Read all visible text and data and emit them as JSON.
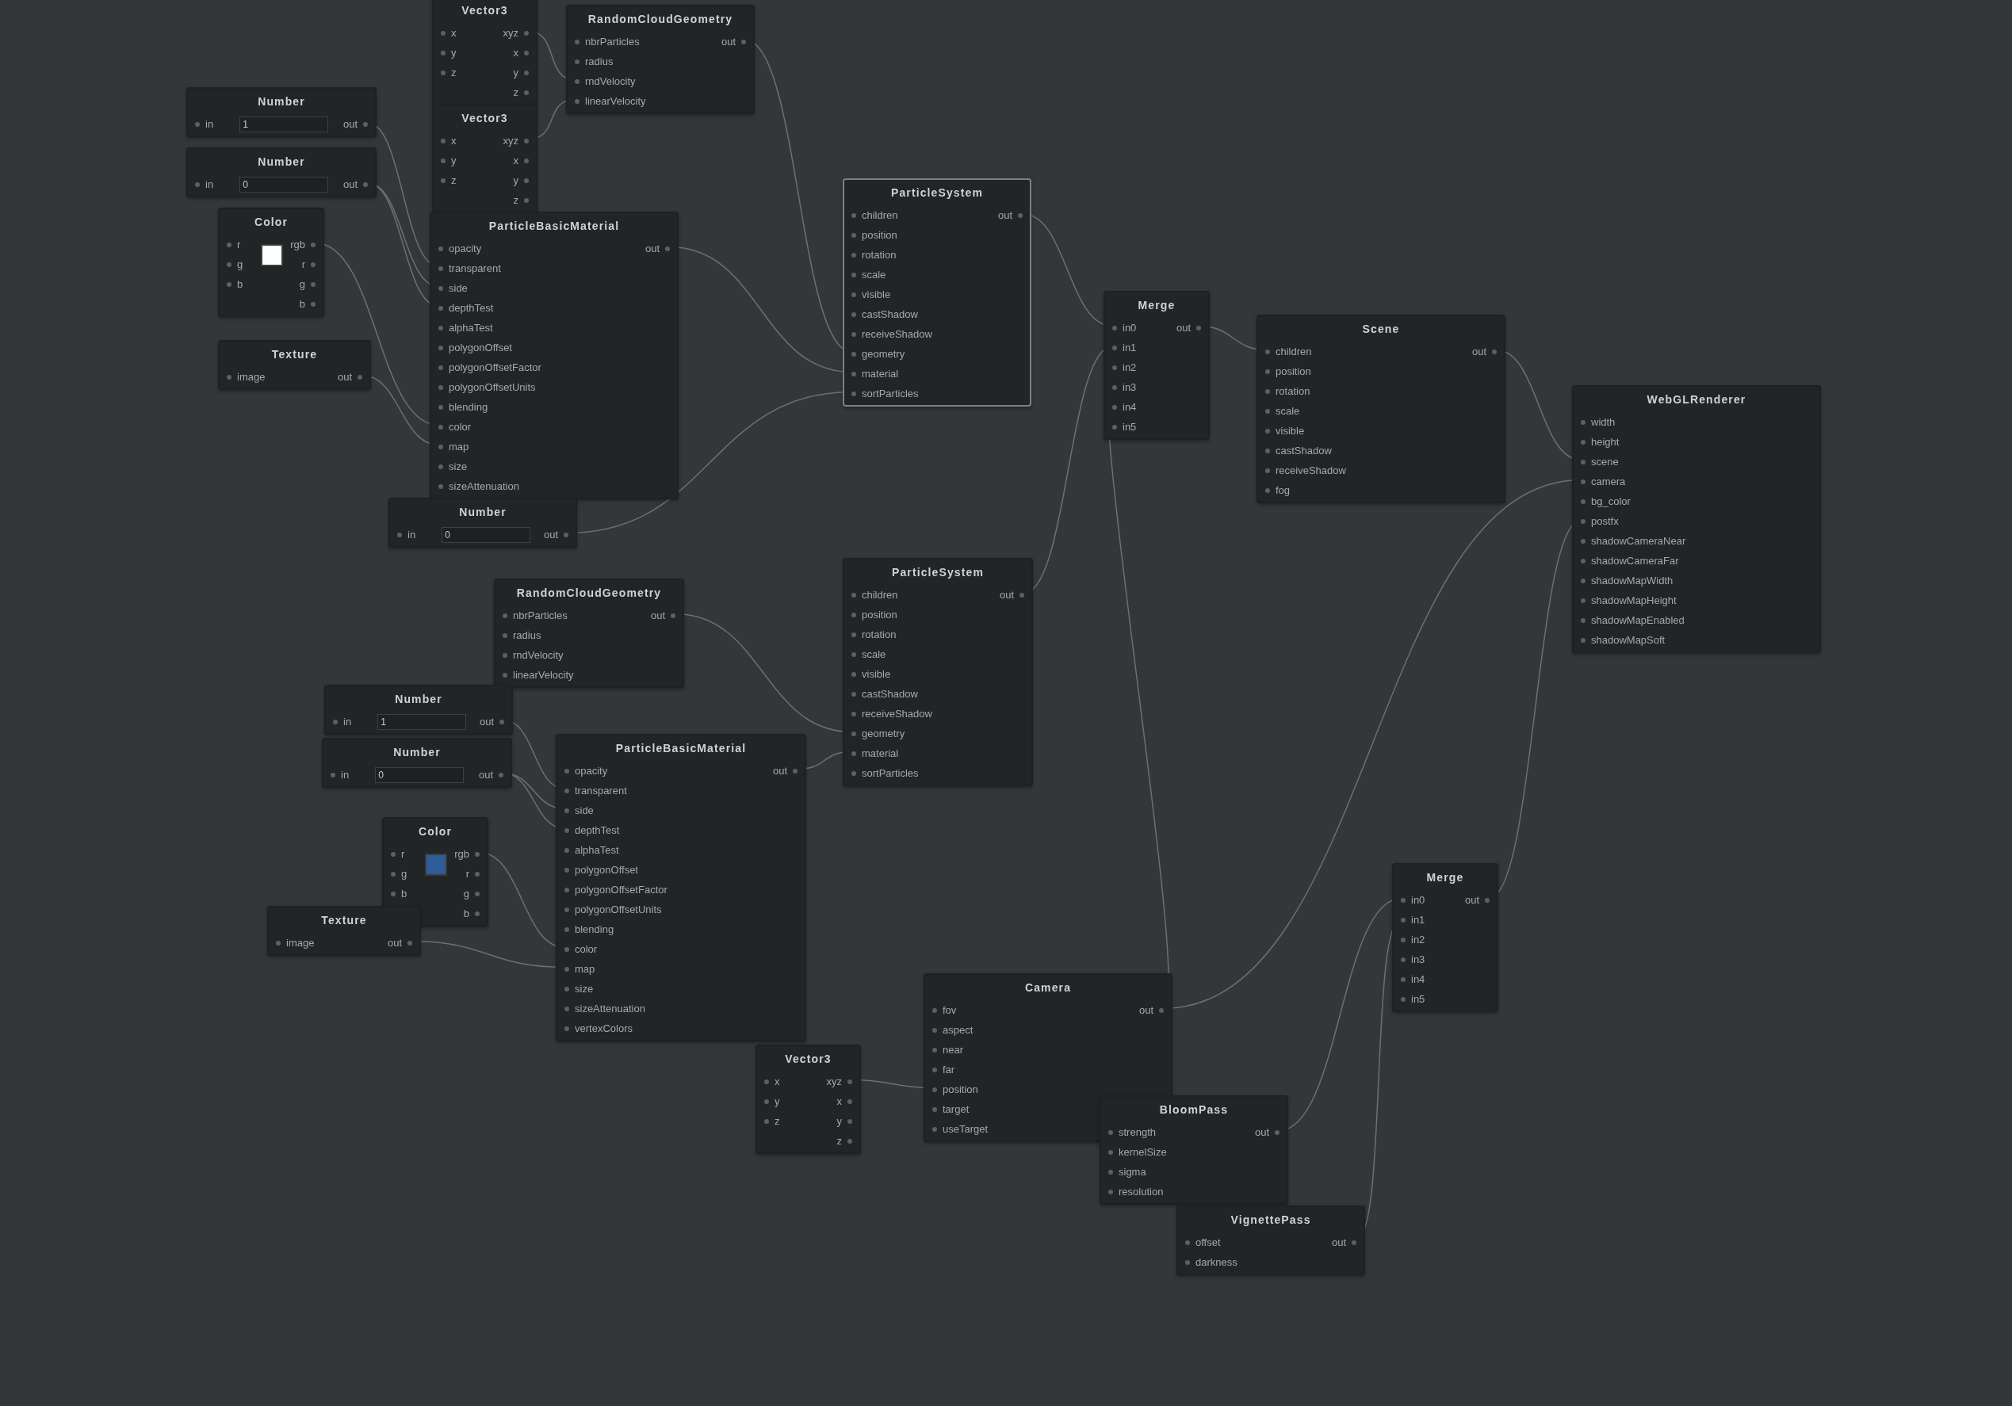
{
  "nodes": [
    {
      "kind": "basic",
      "title": "Vector3",
      "selected": false,
      "inputs": [
        "x",
        "y",
        "z"
      ],
      "outputs": [
        "xyz",
        "x",
        "y",
        "z"
      ]
    },
    {
      "kind": "basic",
      "title": "RandomCloudGeometry",
      "selected": false,
      "inputs": [
        "nbrParticles",
        "radius",
        "rndVelocity",
        "linearVelocity"
      ],
      "outputs": [
        "out"
      ]
    },
    {
      "kind": "number",
      "title": "Number",
      "selected": false,
      "inputs": [
        "in"
      ],
      "outputs": [
        "out"
      ],
      "value": "1"
    },
    {
      "kind": "number",
      "title": "Number",
      "selected": false,
      "inputs": [
        "in"
      ],
      "outputs": [
        "out"
      ],
      "value": "0"
    },
    {
      "kind": "basic",
      "title": "Vector3",
      "selected": false,
      "inputs": [
        "x",
        "y",
        "z"
      ],
      "outputs": [
        "xyz",
        "x",
        "y",
        "z"
      ]
    },
    {
      "kind": "color",
      "title": "Color",
      "selected": false,
      "inputs": [
        "r",
        "g",
        "b"
      ],
      "outputs": [
        "rgb",
        "r",
        "g",
        "b"
      ],
      "color": "#ffffff"
    },
    {
      "kind": "basic",
      "title": "ParticleBasicMaterial",
      "selected": false,
      "inputs": [
        "opacity",
        "transparent",
        "side",
        "depthTest",
        "alphaTest",
        "polygonOffset",
        "polygonOffsetFactor",
        "polygonOffsetUnits",
        "blending",
        "color",
        "map",
        "size",
        "sizeAttenuation"
      ],
      "outputs": [
        "out"
      ]
    },
    {
      "kind": "basic",
      "title": "Texture",
      "selected": false,
      "inputs": [
        "image"
      ],
      "outputs": [
        "out"
      ]
    },
    {
      "kind": "number",
      "title": "Number",
      "selected": false,
      "inputs": [
        "in"
      ],
      "outputs": [
        "out"
      ],
      "value": "0"
    },
    {
      "kind": "basic",
      "title": "ParticleSystem",
      "selected": true,
      "inputs": [
        "children",
        "position",
        "rotation",
        "scale",
        "visible",
        "castShadow",
        "receiveShadow",
        "geometry",
        "material",
        "sortParticles"
      ],
      "outputs": [
        "out"
      ]
    },
    {
      "kind": "basic",
      "title": "Merge",
      "selected": false,
      "inputs": [
        "in0",
        "in1",
        "in2",
        "in3",
        "in4",
        "in5"
      ],
      "outputs": [
        "out"
      ]
    },
    {
      "kind": "basic",
      "title": "Scene",
      "selected": false,
      "inputs": [
        "children",
        "position",
        "rotation",
        "scale",
        "visible",
        "castShadow",
        "receiveShadow",
        "fog"
      ],
      "outputs": [
        "out"
      ]
    },
    {
      "kind": "basic",
      "title": "WebGLRenderer",
      "selected": false,
      "inputs": [
        "width",
        "height",
        "scene",
        "camera",
        "bg_color",
        "postfx",
        "shadowCameraNear",
        "shadowCameraFar",
        "shadowMapWidth",
        "shadowMapHeight",
        "shadowMapEnabled",
        "shadowMapSoft"
      ]
    },
    {
      "kind": "basic",
      "title": "RandomCloudGeometry",
      "selected": false,
      "inputs": [
        "nbrParticles",
        "radius",
        "rndVelocity",
        "linearVelocity"
      ],
      "outputs": [
        "out"
      ]
    },
    {
      "kind": "basic",
      "title": "ParticleSystem",
      "selected": false,
      "inputs": [
        "children",
        "position",
        "rotation",
        "scale",
        "visible",
        "castShadow",
        "receiveShadow",
        "geometry",
        "material",
        "sortParticles"
      ],
      "outputs": [
        "out"
      ]
    },
    {
      "kind": "number",
      "title": "Number",
      "selected": false,
      "inputs": [
        "in"
      ],
      "outputs": [
        "out"
      ],
      "value": "1"
    },
    {
      "kind": "number",
      "title": "Number",
      "selected": false,
      "inputs": [
        "in"
      ],
      "outputs": [
        "out"
      ],
      "value": "0"
    },
    {
      "kind": "basic",
      "title": "ParticleBasicMaterial",
      "selected": false,
      "inputs": [
        "opacity",
        "transparent",
        "side",
        "depthTest",
        "alphaTest",
        "polygonOffset",
        "polygonOffsetFactor",
        "polygonOffsetUnits",
        "blending",
        "color",
        "map",
        "size",
        "sizeAttenuation",
        "vertexColors"
      ],
      "outputs": [
        "out"
      ]
    },
    {
      "kind": "color",
      "title": "Color",
      "selected": false,
      "inputs": [
        "r",
        "g",
        "b"
      ],
      "outputs": [
        "rgb",
        "r",
        "g",
        "b"
      ],
      "color": "#2f5c96"
    },
    {
      "kind": "basic",
      "title": "Texture",
      "selected": false,
      "inputs": [
        "image"
      ],
      "outputs": [
        "out"
      ]
    },
    {
      "kind": "basic",
      "title": "Vector3",
      "selected": false,
      "inputs": [
        "x",
        "y",
        "z"
      ],
      "outputs": [
        "xyz",
        "x",
        "y",
        "z"
      ]
    },
    {
      "kind": "basic",
      "title": "Camera",
      "selected": false,
      "inputs": [
        "fov",
        "aspect",
        "near",
        "far",
        "position",
        "target",
        "useTarget"
      ],
      "outputs": [
        "out"
      ]
    },
    {
      "kind": "basic",
      "title": "BloomPass",
      "selected": false,
      "inputs": [
        "strength",
        "kernelSize",
        "sigma",
        "resolution"
      ],
      "outputs": [
        "out"
      ]
    },
    {
      "kind": "basic",
      "title": "VignettePass",
      "selected": false,
      "inputs": [
        "offset",
        "darkness"
      ],
      "outputs": [
        "out"
      ]
    },
    {
      "kind": "basic",
      "title": "Merge",
      "selected": false,
      "inputs": [
        "in0",
        "in1",
        "in2",
        "in3",
        "in4",
        "in5"
      ],
      "outputs": [
        "out"
      ]
    }
  ]
}
